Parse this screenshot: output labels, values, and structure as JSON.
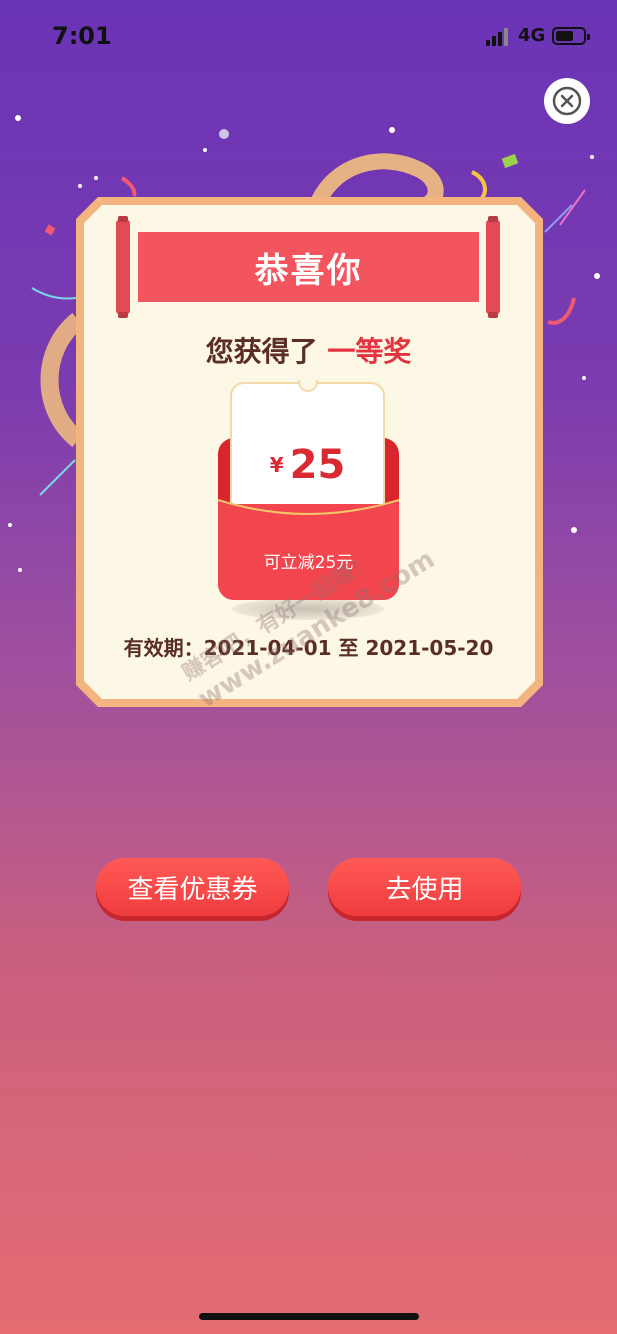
{
  "status_bar": {
    "time": "7:01",
    "network": "4G",
    "battery_level": 0.65
  },
  "close_icon": "close-x-icon",
  "card": {
    "banner_title": "恭喜你",
    "prize_prefix": "您获得了",
    "prize_level": "一等奖",
    "coupon": {
      "currency": "¥",
      "amount": "25",
      "description": "可立减25元"
    },
    "validity": "有效期：2021-04-01 至 2021-05-20"
  },
  "watermark": {
    "line1": "赚客吧，有好一起赚！",
    "line2": "www.zuanke8.com"
  },
  "buttons": {
    "view_coupons": "查看优惠券",
    "use": "去使用"
  },
  "colors": {
    "accent_red": "#f03c3f",
    "card_border": "#f4b47f",
    "card_bg": "#fdf7e6"
  }
}
